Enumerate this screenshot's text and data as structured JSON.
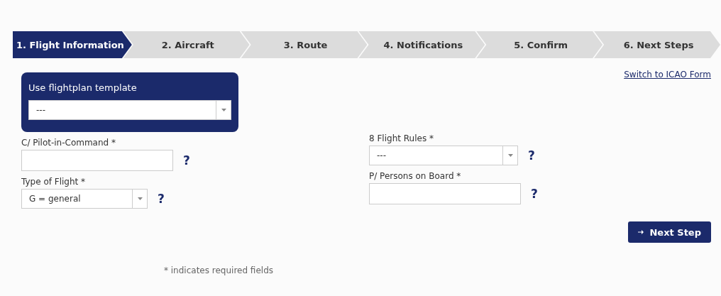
{
  "steps": [
    {
      "label": "1. Flight Information",
      "selected": true
    },
    {
      "label": "2. Aircraft",
      "selected": false
    },
    {
      "label": "3. Route",
      "selected": false
    },
    {
      "label": "4. Notifications",
      "selected": false
    },
    {
      "label": "5. Confirm",
      "selected": false
    },
    {
      "label": "6. Next Steps",
      "selected": false
    }
  ],
  "template": {
    "label": "Use flightplan template",
    "value": "---"
  },
  "switch_link": "Switch to ICAO Form",
  "left_fields": [
    {
      "label": "C/ Pilot-in-Command *",
      "kind": "text",
      "help": "?"
    },
    {
      "label": "Type of Flight *",
      "kind": "select",
      "value": "G = general",
      "help": "?"
    }
  ],
  "right_fields": [
    {
      "label": "8 Flight Rules *",
      "kind": "select",
      "value": "---",
      "help": "?"
    },
    {
      "label": "P/ Persons on Board *",
      "kind": "text",
      "help": "?"
    }
  ],
  "next_button": "Next Step",
  "footnote": "* indicates required fields"
}
